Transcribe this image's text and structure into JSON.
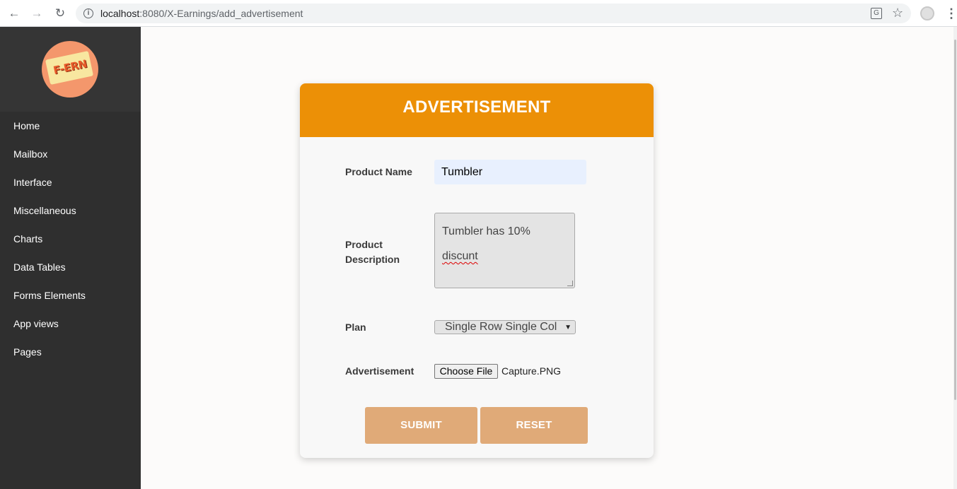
{
  "browser": {
    "url_host": "localhost",
    "url_rest": ":8080/X-Earnings/add_advertisement"
  },
  "sidebar": {
    "logo_text": "F-ERN",
    "items": [
      {
        "label": "Home"
      },
      {
        "label": "Mailbox"
      },
      {
        "label": "Interface"
      },
      {
        "label": "Miscellaneous"
      },
      {
        "label": "Charts"
      },
      {
        "label": "Data Tables"
      },
      {
        "label": "Forms Elements"
      },
      {
        "label": "App views"
      },
      {
        "label": "Pages"
      }
    ]
  },
  "form": {
    "title": "ADVERTISEMENT",
    "product_name_label": "Product Name",
    "product_name_value": "Tumbler",
    "product_description_label": "Product Description",
    "product_description_line1": "Tumbler has 10%",
    "product_description_line2": "discunt",
    "plan_label": "Plan",
    "plan_value": "Single Row Single Column",
    "advertisement_label": "Advertisement",
    "choose_file_label": "Choose File",
    "file_name": "Capture.PNG",
    "submit_label": "SUBMIT",
    "reset_label": "RESET"
  },
  "colors": {
    "header": "#ec9006",
    "button": "#e0aa78",
    "sidebar": "#2f2f2f",
    "logo": "#f4976c"
  }
}
